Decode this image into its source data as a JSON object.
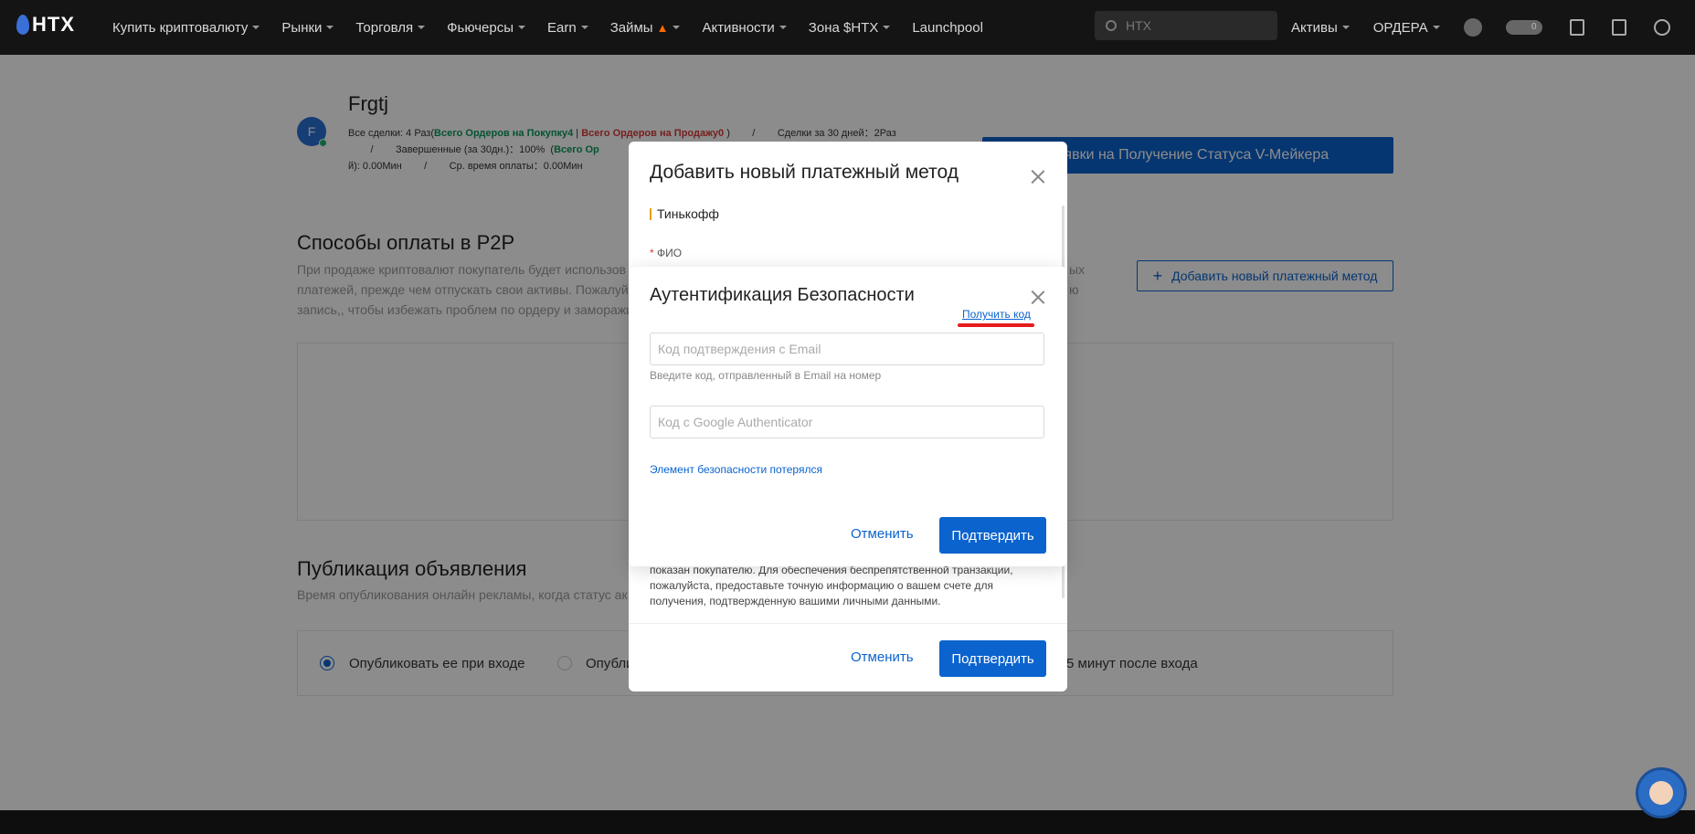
{
  "nav": {
    "logo": "HTX",
    "items": [
      {
        "label": "Купить криптовалюту",
        "caret": true
      },
      {
        "label": "Рынки",
        "caret": true
      },
      {
        "label": "Торговля",
        "caret": true
      },
      {
        "label": "Фьючерсы",
        "caret": true
      },
      {
        "label": "Earn",
        "caret": true
      },
      {
        "label": "Займы",
        "caret": true
      },
      {
        "label": "Активности",
        "caret": true
      },
      {
        "label": "Зона $HTX",
        "caret": true
      },
      {
        "label": "Launchpool",
        "caret": false
      }
    ],
    "search_placeholder": "HTX",
    "assets_label": "Активы",
    "orders_label": "ОРДЕРА",
    "pill_count": "0"
  },
  "profile": {
    "avatar_letter": "F",
    "name": "Frgtj",
    "line1_prefix": "Все сделки: 4 Раз(",
    "buy_label": "Всего Ордеров на Покупку",
    "buy_count": "4",
    "sep": " | ",
    "sell_label": "Всего Ордеров на Продажу",
    "sell_count": "0",
    "line1_suffix": " )        /        Сделки за 30 дней：2Раз",
    "line2": "        /        Завершенные (за 30дн.)：100%  (",
    "line2_green": "Всего Ор",
    "line3": "й): 0.00Мин        /        Ср. время оплаты：0.00Мин",
    "vmaker_btn": "Заявки на Получение Статуса V-Мейкера"
  },
  "payments": {
    "title": "Способы оплаты в P2P",
    "desc_lines": [
      "При продаже криптовалют покупатель будет использов",
      "платежей, прежде чем отпускать свои активы. Пожалуй",
      "запись,, чтобы избежать проблем по ордеру и заморажи"
    ],
    "desc_right_1": "ых",
    "desc_right_2": "ю",
    "add_btn": "Добавить новый платежный метод"
  },
  "publication": {
    "title": "Публикация объявления",
    "desc": "Время опубликования онлайн рекламы, когда статус ак",
    "option1": "Опубликовать ее при входе",
    "option2": "Опубли",
    "option3": "5 минут после входа"
  },
  "back_dialog": {
    "title": "Добавить новый платежный метод",
    "method": "Тинькофф",
    "fio_label": "ФИО",
    "note_lines": [
      "показан покупателю. Для обеспечения беспрепятственной транзакции,",
      "пожалуйста, предоставьте точную информацию о вашем счете для",
      "получения, подтвержденную вашими личными данными."
    ],
    "cancel": "Отменить",
    "confirm": "Подтвердить"
  },
  "security_dialog": {
    "title": "Аутентификация Безопасности",
    "email_placeholder": "Код подтверждения с Email",
    "get_code": "Получить код",
    "email_hint": "Введите код, отправленный в Email на номер",
    "google_placeholder": "Код с Google Authenticator",
    "lost_link": "Элемент безопасности потерялся",
    "cancel": "Отменить",
    "confirm": "Подтвердить"
  },
  "colors": {
    "accent": "#0b63ce",
    "buy": "#0a9a5a",
    "sell": "#d83a3a",
    "highlight_mark": "#e61c1c"
  }
}
